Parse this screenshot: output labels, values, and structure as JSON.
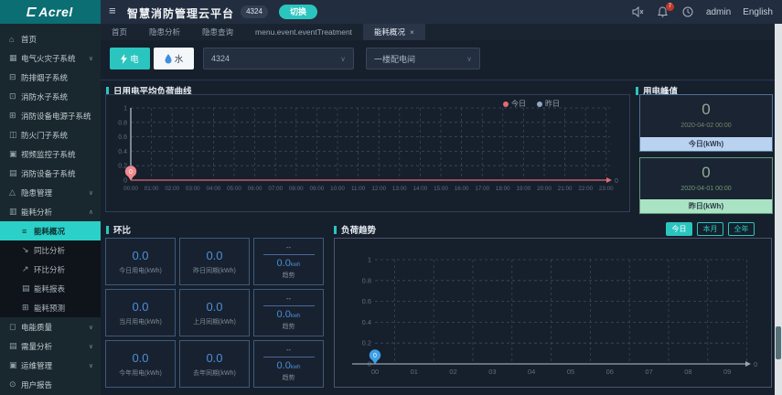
{
  "header": {
    "logo": "Acrel",
    "title": "智慧消防管理云平台",
    "badge": "4324",
    "switch_label": "切换",
    "bell_badge": "7",
    "user": "admin",
    "lang": "English"
  },
  "tabs": [
    {
      "label": "首页",
      "active": false,
      "closable": false
    },
    {
      "label": "隐患分析",
      "active": false,
      "closable": false
    },
    {
      "label": "隐患查询",
      "active": false,
      "closable": false
    },
    {
      "label": "menu.event.eventTreatment",
      "active": false,
      "closable": false
    },
    {
      "label": "能耗概况",
      "active": true,
      "closable": true
    }
  ],
  "sidebar": {
    "items_top": [
      {
        "label": "首页",
        "icon": "home",
        "chevron": ""
      },
      {
        "label": "电气火灾子系统",
        "icon": "electric-fire",
        "chevron": "down"
      },
      {
        "label": "防排烟子系统",
        "icon": "smoke-control",
        "chevron": ""
      },
      {
        "label": "消防水子系统",
        "icon": "fire-water",
        "chevron": ""
      },
      {
        "label": "消防设备电源子系统",
        "icon": "equipment-power",
        "chevron": ""
      },
      {
        "label": "防火门子系统",
        "icon": "fire-door",
        "chevron": ""
      },
      {
        "label": "视频监控子系统",
        "icon": "video-monitor",
        "chevron": ""
      },
      {
        "label": "消防设备子系统",
        "icon": "fire-equipment",
        "chevron": ""
      },
      {
        "label": "隐患管理",
        "icon": "hazard-manage",
        "chevron": "down"
      },
      {
        "label": "能耗分析",
        "icon": "energy-analysis",
        "chevron": "up"
      }
    ],
    "submenu": [
      {
        "label": "能耗概况",
        "icon": "overview-list",
        "active": true
      },
      {
        "label": "同比分析",
        "icon": "yoy-trend",
        "active": false
      },
      {
        "label": "环比分析",
        "icon": "mom-trend",
        "active": false
      },
      {
        "label": "能耗报表",
        "icon": "energy-report",
        "active": false
      },
      {
        "label": "能耗预测",
        "icon": "energy-forecast",
        "active": false
      }
    ],
    "items_bottom": [
      {
        "label": "电能质量",
        "icon": "power-quality",
        "chevron": "down"
      },
      {
        "label": "需量分析",
        "icon": "demand-analysis",
        "chevron": "down"
      },
      {
        "label": "运维管理",
        "icon": "ops-manage",
        "chevron": "down"
      },
      {
        "label": "用户报告",
        "icon": "user-report",
        "chevron": ""
      }
    ]
  },
  "filters": {
    "electric_label": "电",
    "water_label": "水",
    "building_select": "4324",
    "room_select": "一楼配电间"
  },
  "load_curve": {
    "title": "日用电平均负荷曲线",
    "type": "line",
    "legend": [
      {
        "name": "今日",
        "color": "#e66a6f"
      },
      {
        "name": "昨日",
        "color": "#93a7c4"
      }
    ],
    "y_ticks": [
      "1",
      "0.8",
      "0.6",
      "0.4",
      "0.2",
      "0"
    ],
    "x_ticks": [
      "00:00",
      "01:00",
      "02:00",
      "03:00",
      "04:00",
      "05:00",
      "06:00",
      "07:00",
      "08:00",
      "09:00",
      "10:00",
      "11:00",
      "12:00",
      "13:00",
      "14:00",
      "15:00",
      "16:00",
      "17:00",
      "18:00",
      "19:00",
      "20:00",
      "21:00",
      "22:00",
      "23:00"
    ],
    "today_constant_value": 0,
    "pin_label": "0",
    "axis_end_label": "0",
    "line_color": "#e06b70",
    "pin_color": "#ef8a8d",
    "grid_color": "#3c4a60",
    "label_color": "#5f6e80"
  },
  "peak": {
    "title": "用电峰值",
    "cards": [
      {
        "value": "0",
        "time": "2020-04-02 00:00",
        "label": "今日(kWh)",
        "strip_color": "#b9d2f0",
        "border_color": "#4f7396",
        "value_color": "#9aa896",
        "time_color": "#77866b"
      },
      {
        "value": "0",
        "time": "2020-04-01 00:00",
        "label": "昨日(kWh)",
        "strip_color": "#a9e3c3",
        "border_color": "#619a7c",
        "value_color": "#8fae92",
        "time_color": "#6f9a6f"
      }
    ]
  },
  "huanbi": {
    "title": "环比",
    "rows": [
      {
        "cells": [
          {
            "value": "0.0",
            "label": "今日用电(kWh)"
          },
          {
            "value": "0.0",
            "label": "昨日同期(kWh)"
          }
        ],
        "trend": {
          "placeholder": "--",
          "value": "0.0",
          "unit": "kwh",
          "label": "趋势"
        }
      },
      {
        "cells": [
          {
            "value": "0.0",
            "label": "当月用电(kWh)"
          },
          {
            "value": "0.0",
            "label": "上月同期(kWh)"
          }
        ],
        "trend": {
          "placeholder": "--",
          "value": "0.0",
          "unit": "kwh",
          "label": "趋势"
        }
      },
      {
        "cells": [
          {
            "value": "0.0",
            "label": "今年用电(kWh)"
          },
          {
            "value": "0.0",
            "label": "去年同期(kWh)"
          }
        ],
        "trend": {
          "placeholder": "--",
          "value": "0.0",
          "unit": "kwh",
          "label": "趋势"
        }
      }
    ]
  },
  "load_trend": {
    "title": "负荷趋势",
    "type": "line",
    "buttons": [
      {
        "label": "今日",
        "active": true
      },
      {
        "label": "本月",
        "active": false
      },
      {
        "label": "全年",
        "active": false
      }
    ],
    "y_ticks": [
      "1",
      "0.8",
      "0.6",
      "0.4",
      "0.2",
      "0"
    ],
    "x_ticks": [
      "00",
      "01",
      "02",
      "03",
      "04",
      "05",
      "06",
      "07",
      "08",
      "09"
    ],
    "today_constant_value": 0,
    "pin_label": "0",
    "axis_end_label": "0",
    "axis_color": "#9aa5b1",
    "pin_color": "#3da0e8",
    "grid_color": "#3c4a60",
    "label_color": "#5f6e80"
  }
}
